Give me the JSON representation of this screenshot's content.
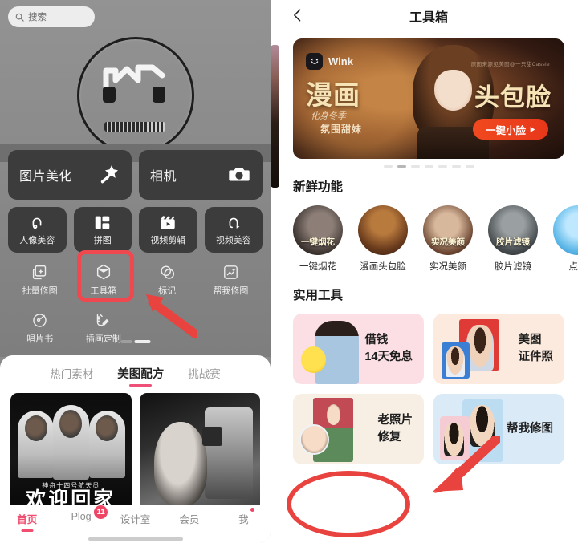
{
  "left_app": {
    "search": {
      "placeholder": "搜索",
      "icon": "search-icon"
    },
    "hero_logo_alt": "MT",
    "primary_buttons": [
      {
        "label": "图片美化",
        "icon": "magic-wand-icon"
      },
      {
        "label": "相机",
        "icon": "camera-icon"
      }
    ],
    "secondary_buttons": [
      {
        "label": "人像美容",
        "icon": "portrait-beauty-icon"
      },
      {
        "label": "拼图",
        "icon": "collage-icon"
      },
      {
        "label": "视频剪辑",
        "icon": "video-edit-icon"
      },
      {
        "label": "视频美容",
        "icon": "video-beauty-icon"
      }
    ],
    "tertiary_buttons": [
      {
        "label": "批量修图",
        "icon": "batch-edit-icon"
      },
      {
        "label": "工具箱",
        "icon": "toolbox-icon"
      },
      {
        "label": "标记",
        "icon": "mark-icon"
      },
      {
        "label": "帮我修图",
        "icon": "help-edit-icon"
      }
    ],
    "quaternary_buttons": [
      {
        "label": "唱片书",
        "icon": "record-book-icon"
      },
      {
        "label": "插画定制",
        "icon": "illustration-custom-icon"
      }
    ],
    "sheet_tabs": [
      {
        "label": "热门素材",
        "active": false
      },
      {
        "label": "美图配方",
        "active": true
      },
      {
        "label": "挑战赛",
        "active": false
      }
    ],
    "feed_cards": [
      {
        "caption_small": "神舟十四号航天员",
        "caption_big": "欢迎回家"
      },
      {
        "caption_small": "",
        "caption_big": ""
      }
    ],
    "bottom_nav": [
      {
        "label": "首页",
        "active": true,
        "badge": "",
        "dot": false
      },
      {
        "label": "Plog",
        "active": false,
        "badge": "11",
        "dot": false
      },
      {
        "label": "设计室",
        "active": false,
        "badge": "",
        "dot": false
      },
      {
        "label": "会员",
        "active": false,
        "badge": "",
        "dot": false
      },
      {
        "label": "我",
        "active": false,
        "badge": "",
        "dot": true
      }
    ]
  },
  "right_app": {
    "header": {
      "title": "工具箱",
      "back_icon": "chevron-left-icon"
    },
    "banner": {
      "brand": "Wink",
      "brand_icon": "wink-logo-icon",
      "headline_left": "漫画",
      "headline_right": "头包脸",
      "subtitle_1": "化身冬季",
      "subtitle_2": "氛围甜妹",
      "cta_label": "一键小脸",
      "cta_icon": "play-arrow-icon",
      "fine_print": "原图来源见美图@一只甜Cassie",
      "dots_total": 7,
      "dot_active_index": 1
    },
    "fresh_section": {
      "title": "新鲜功能",
      "items": [
        {
          "label": "一键烟花",
          "overlay": "一键烟花"
        },
        {
          "label": "漫画头包脸",
          "overlay": ""
        },
        {
          "label": "实况美颜",
          "overlay": "实况美颜"
        },
        {
          "label": "胶片滤镜",
          "overlay": "胶片滤镜"
        },
        {
          "label": "点击",
          "overlay": ""
        }
      ]
    },
    "tools_section": {
      "title": "实用工具",
      "items": [
        {
          "line1": "借钱",
          "line2": "14天免息"
        },
        {
          "line1": "美图",
          "line2": "证件照"
        },
        {
          "line1": "老照片",
          "line2": "修复"
        },
        {
          "line1": "帮我修图",
          "line2": ""
        }
      ]
    }
  },
  "annotations": {
    "highlight_box_target": "工具箱",
    "highlight_ellipse_target": "老照片修复",
    "color": "#e8433f"
  }
}
